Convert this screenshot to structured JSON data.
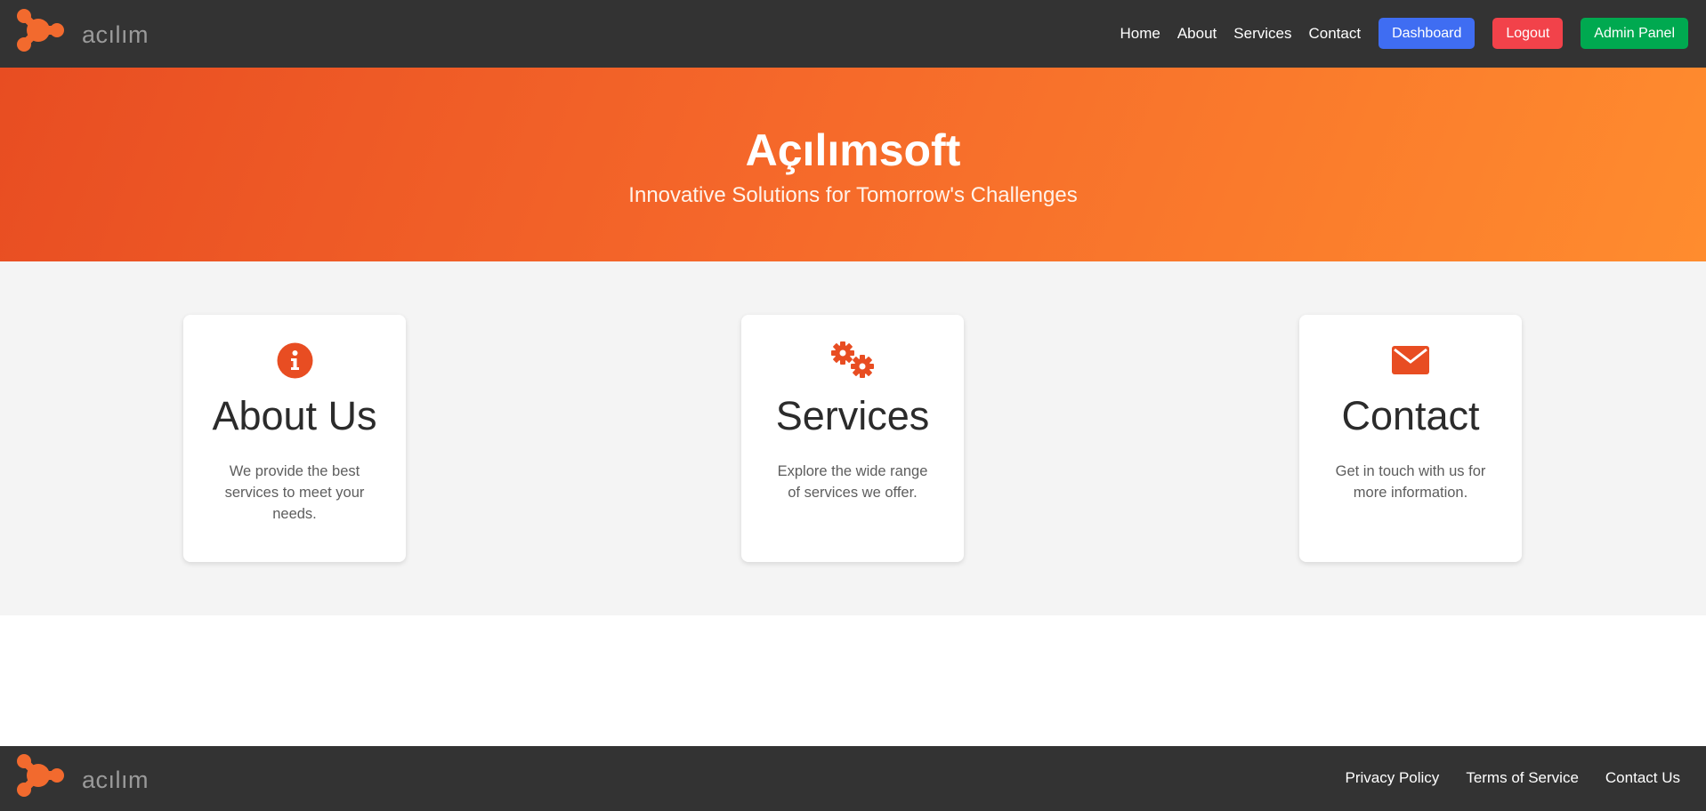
{
  "header": {
    "logo_text": "acılım",
    "nav": [
      "Home",
      "About",
      "Services",
      "Contact"
    ],
    "buttons": [
      {
        "label": "Dashboard",
        "color": "#3f6df2"
      },
      {
        "label": "Logout",
        "color": "#f2424a"
      },
      {
        "label": "Admin Panel",
        "color": "#00a950"
      }
    ]
  },
  "hero": {
    "title": "Açılımsoft",
    "subtitle": "Innovative Solutions for Tomorrow's Challenges",
    "gradient": [
      "#e84d22",
      "#ff8c2e"
    ]
  },
  "cards": [
    {
      "icon": "info-circle-icon",
      "title": "About Us",
      "description": "We provide the best services to meet your needs."
    },
    {
      "icon": "gears-icon",
      "title": "Services",
      "description": "Explore the wide range of services we offer."
    },
    {
      "icon": "envelope-icon",
      "title": "Contact",
      "description": "Get in touch with us for more information."
    }
  ],
  "footer": {
    "logo_text": "acılım",
    "links": [
      "Privacy Policy",
      "Terms of Service",
      "Contact Us"
    ]
  },
  "colors": {
    "accent": "#e84d22",
    "dark_bar": "#333333",
    "section_bg": "#f4f4f4"
  }
}
